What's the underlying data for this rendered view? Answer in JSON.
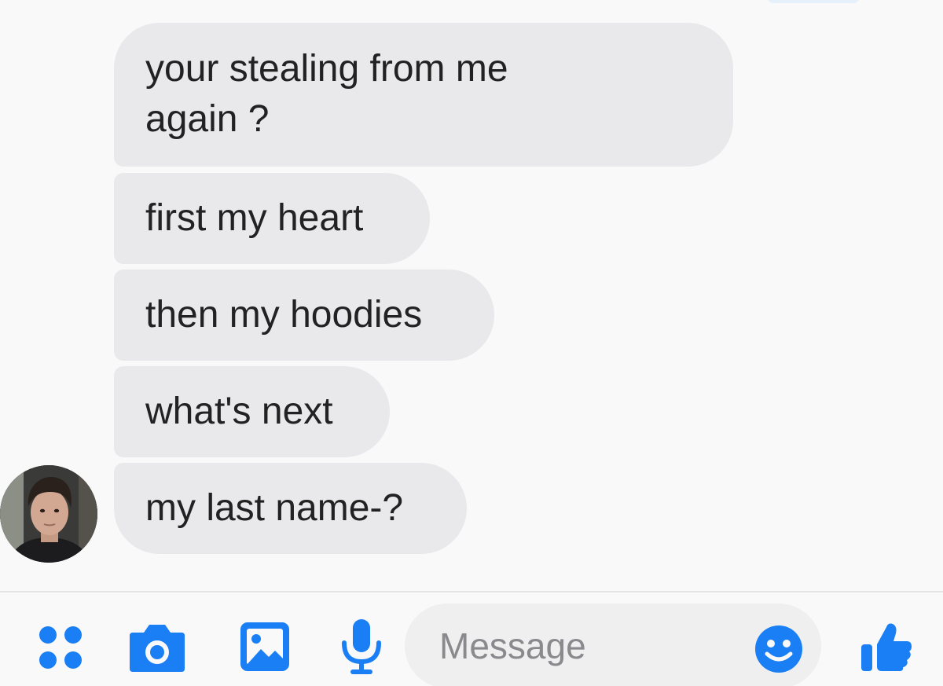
{
  "colors": {
    "accent": "#1a7ff5",
    "bubble_bg": "#e9e9eb",
    "background": "#f9f9fa"
  },
  "messages": [
    {
      "text": "your stealing from me\nagain ?"
    },
    {
      "text": "first my heart"
    },
    {
      "text": "then my hoodies"
    },
    {
      "text": "what's next"
    },
    {
      "text": "my last name-?"
    }
  ],
  "composer": {
    "placeholder": "Message",
    "icons": [
      "more-icon",
      "camera-icon",
      "gallery-icon",
      "microphone-icon",
      "emoji-icon",
      "thumbs-up-icon"
    ]
  }
}
